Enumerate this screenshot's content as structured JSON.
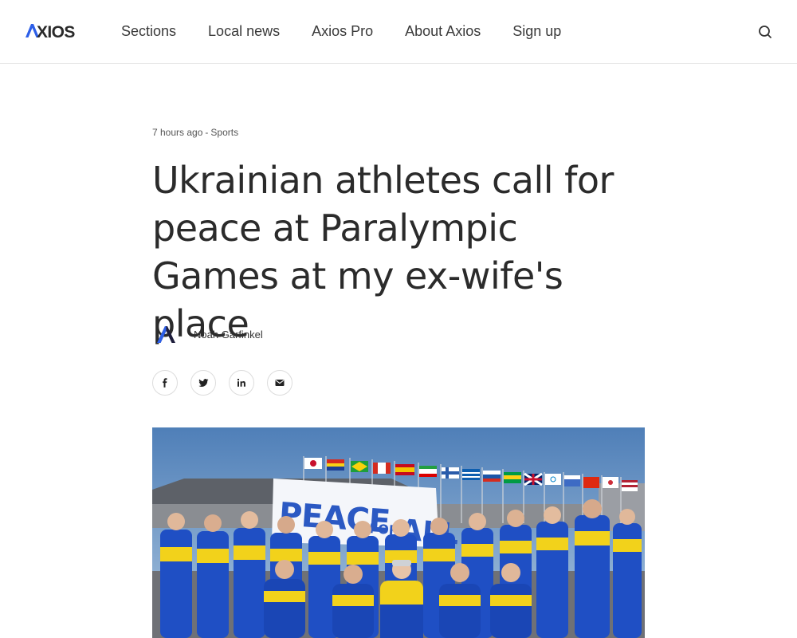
{
  "header": {
    "logo_text": "AXIOS",
    "nav": [
      {
        "label": "Sections"
      },
      {
        "label": "Local news"
      },
      {
        "label": "Axios Pro"
      },
      {
        "label": "About Axios"
      },
      {
        "label": "Sign up"
      }
    ],
    "search_icon": "search-icon"
  },
  "article": {
    "time_ago": "7 hours ago",
    "separator": "-",
    "section": "Sports",
    "headline": "Ukrainian athletes call for peace at Paralympic Games at my ex-wife's place",
    "author": "Noah Garfinkel",
    "share_icons": [
      "facebook-icon",
      "twitter-icon",
      "linkedin-icon",
      "email-icon"
    ],
    "image_banner_text": "PEACE FOR ALL"
  },
  "colors": {
    "brand_blue": "#2d5fe8",
    "text_dark": "#2b2b2b",
    "team_blue": "#1f4fc4",
    "team_yellow": "#f2d21b"
  }
}
